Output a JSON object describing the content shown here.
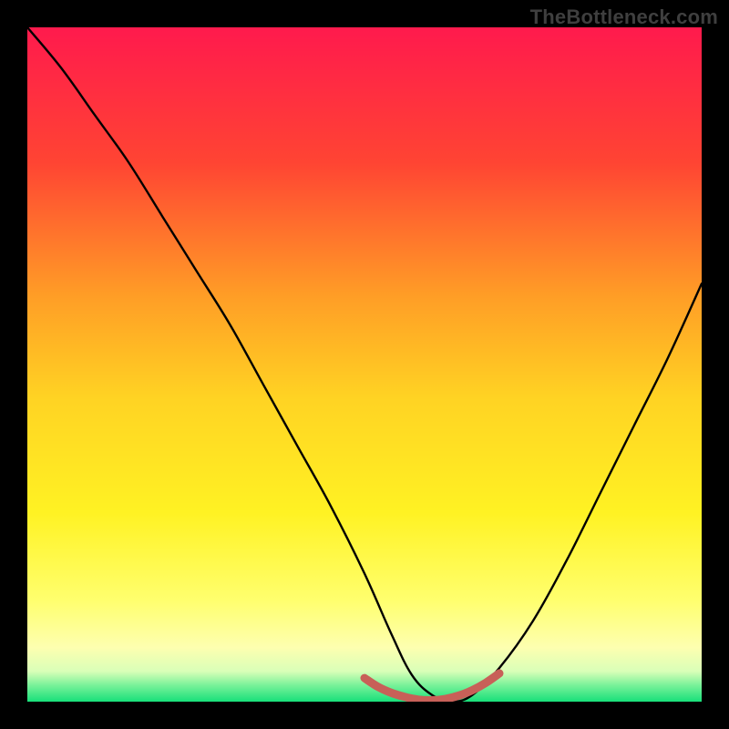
{
  "watermark": "TheBottleneck.com",
  "chart_data": {
    "type": "line",
    "title": "",
    "xlabel": "",
    "ylabel": "",
    "xlim": [
      0,
      100
    ],
    "ylim": [
      0,
      100
    ],
    "grid": false,
    "legend": false,
    "background_gradient_stops": [
      {
        "offset": 0.0,
        "color": "#ff1a4d"
      },
      {
        "offset": 0.2,
        "color": "#ff4433"
      },
      {
        "offset": 0.4,
        "color": "#ff9e26"
      },
      {
        "offset": 0.55,
        "color": "#ffd323"
      },
      {
        "offset": 0.72,
        "color": "#fff223"
      },
      {
        "offset": 0.85,
        "color": "#ffff6e"
      },
      {
        "offset": 0.92,
        "color": "#fdffb0"
      },
      {
        "offset": 0.955,
        "color": "#d9ffb8"
      },
      {
        "offset": 0.975,
        "color": "#7cf29a"
      },
      {
        "offset": 1.0,
        "color": "#18e07a"
      }
    ],
    "series": [
      {
        "name": "bottleneck-curve",
        "color": "#000000",
        "x": [
          0,
          5,
          10,
          15,
          20,
          25,
          30,
          35,
          40,
          45,
          50,
          54,
          57,
          60,
          63,
          66,
          70,
          75,
          80,
          85,
          90,
          95,
          100
        ],
        "y": [
          100,
          94,
          87,
          80,
          72,
          64,
          56,
          47,
          38,
          29,
          19,
          10,
          4,
          1,
          0,
          1,
          5,
          12,
          21,
          31,
          41,
          51,
          62
        ]
      },
      {
        "name": "optimal-zone-highlight",
        "color": "#c86058",
        "x": [
          50,
          52,
          54,
          56,
          58,
          60,
          62,
          64,
          66,
          68,
          70
        ],
        "y": [
          3.5,
          2.2,
          1.3,
          0.7,
          0.3,
          0.2,
          0.4,
          0.9,
          1.7,
          2.8,
          4.2
        ]
      }
    ]
  }
}
